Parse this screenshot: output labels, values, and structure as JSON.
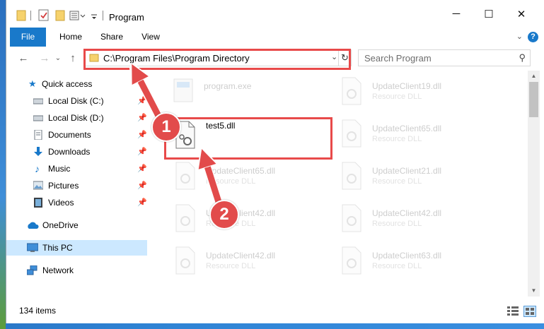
{
  "window": {
    "title": "Program",
    "minimize_glyph": "─",
    "maximize_glyph": "☐",
    "close_glyph": "✕"
  },
  "ribbon": {
    "tabs": [
      "File",
      "Home",
      "Share",
      "View"
    ],
    "help_glyph": "?",
    "expand_glyph": "⌄"
  },
  "navigation": {
    "back_glyph": "←",
    "forward_glyph": "→",
    "recent_glyph": "⌄",
    "up_glyph": "↑",
    "address": "C:\\Program Files\\Program Directory",
    "address_dropdown_glyph": "⌄",
    "refresh_glyph": "↻",
    "search_placeholder": "Search Program",
    "search_glyph": "⚲"
  },
  "sidebar": {
    "items": [
      {
        "label": "Quick access",
        "icon": "star-icon",
        "pinned": false
      },
      {
        "label": "Local Disk (C:)",
        "icon": "drive-icon",
        "pinned": true
      },
      {
        "label": "Local Disk (D:)",
        "icon": "drive-icon",
        "pinned": true
      },
      {
        "label": "Documents",
        "icon": "documents-icon",
        "pinned": true
      },
      {
        "label": "Downloads",
        "icon": "download-icon",
        "pinned": true
      },
      {
        "label": "Music",
        "icon": "music-icon",
        "pinned": true
      },
      {
        "label": "Pictures",
        "icon": "pictures-icon",
        "pinned": true
      },
      {
        "label": "Videos",
        "icon": "videos-icon",
        "pinned": true
      },
      {
        "label": "OneDrive",
        "icon": "cloud-icon",
        "pinned": false
      },
      {
        "label": "This PC",
        "icon": "computer-icon",
        "pinned": false,
        "selected": true
      },
      {
        "label": "Network",
        "icon": "network-icon",
        "pinned": false
      }
    ],
    "pin_glyph": "📌"
  },
  "files": [
    {
      "name": "program.exe",
      "type": "",
      "faded": true
    },
    {
      "name": "UpdateClient19.dll",
      "type": "Resource DLL",
      "faded": true
    },
    {
      "name": "test5.dll",
      "type": "",
      "faded": false
    },
    {
      "name": "UpdateClient65.dll",
      "type": "Resource DLL",
      "faded": true
    },
    {
      "name": "UpdateClient65.dll",
      "type": "Resource DLL",
      "faded": true
    },
    {
      "name": "UpdateClient21.dll",
      "type": "Resource DLL",
      "faded": true
    },
    {
      "name": "UpdateClient42.dll",
      "type": "Resource DLL",
      "faded": true
    },
    {
      "name": "UpdateClient42.dll",
      "type": "Resource DLL",
      "faded": true
    },
    {
      "name": "UpdateClient42.dll",
      "type": "Resource DLL",
      "faded": true
    },
    {
      "name": "UpdateClient63.dll",
      "type": "Resource DLL",
      "faded": true
    }
  ],
  "status": {
    "item_count": "134 items"
  },
  "annotations": {
    "step1": "1",
    "step2": "2",
    "color": "#e24b4b"
  }
}
